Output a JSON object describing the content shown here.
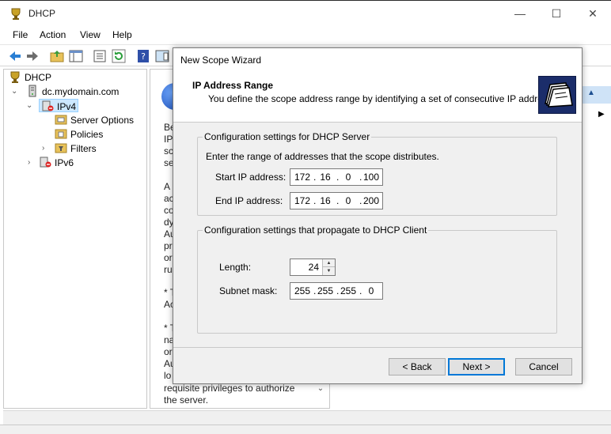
{
  "main_window": {
    "title": "DHCP",
    "controls": {
      "minimize": "—",
      "maximize": "☐",
      "close": "✕"
    }
  },
  "menu": [
    "File",
    "Action",
    "View",
    "Help"
  ],
  "toolbar_icons": [
    "back-arrow-icon",
    "forward-arrow-icon",
    "up-folder-icon",
    "show-hide-tree-icon",
    "properties-icon",
    "refresh-icon",
    "help-icon",
    "action-pane-icon"
  ],
  "tree": {
    "root": "DHCP",
    "server": "dc.mydomain.com",
    "ipv4": "IPv4",
    "server_options": "Server Options",
    "policies": "Policies",
    "filters": "Filters",
    "ipv6": "IPv6"
  },
  "desc_pane": {
    "lines_visible_top": [
      "Be",
      "IP",
      "sc",
      "se"
    ],
    "lines_visible_mid": [
      "A",
      "ac",
      "co",
      "dy",
      "Au",
      "pr",
      "or",
      "ru"
    ],
    "lines_visible_mid2": [
      "* T",
      "Ac"
    ],
    "lines_visible_mid3": [
      "* T",
      "na",
      "or",
      "Au",
      "lo"
    ],
    "last_line_1": "requisite privileges to authorize",
    "last_line_2": "the server."
  },
  "wizard": {
    "title": "New Scope Wizard",
    "header_title": "IP Address Range",
    "header_subtitle": "You define the scope address range by identifying a set of consecutive IP addresses.",
    "server_group": {
      "label": "Configuration settings for DHCP Server",
      "instruction": "Enter the range of addresses that the scope distributes.",
      "start_label": "Start IP address:",
      "start_ip": [
        "172",
        "16",
        "0",
        "100"
      ],
      "end_label": "End IP address:",
      "end_ip": [
        "172",
        "16",
        "0",
        "200"
      ]
    },
    "client_group": {
      "label": "Configuration settings that propagate to DHCP Client",
      "length_label": "Length:",
      "length_value": "24",
      "mask_label": "Subnet mask:",
      "mask": [
        "255",
        "255",
        "255",
        "0"
      ]
    },
    "buttons": {
      "back": "< Back",
      "next": "Next >",
      "cancel": "Cancel"
    }
  }
}
